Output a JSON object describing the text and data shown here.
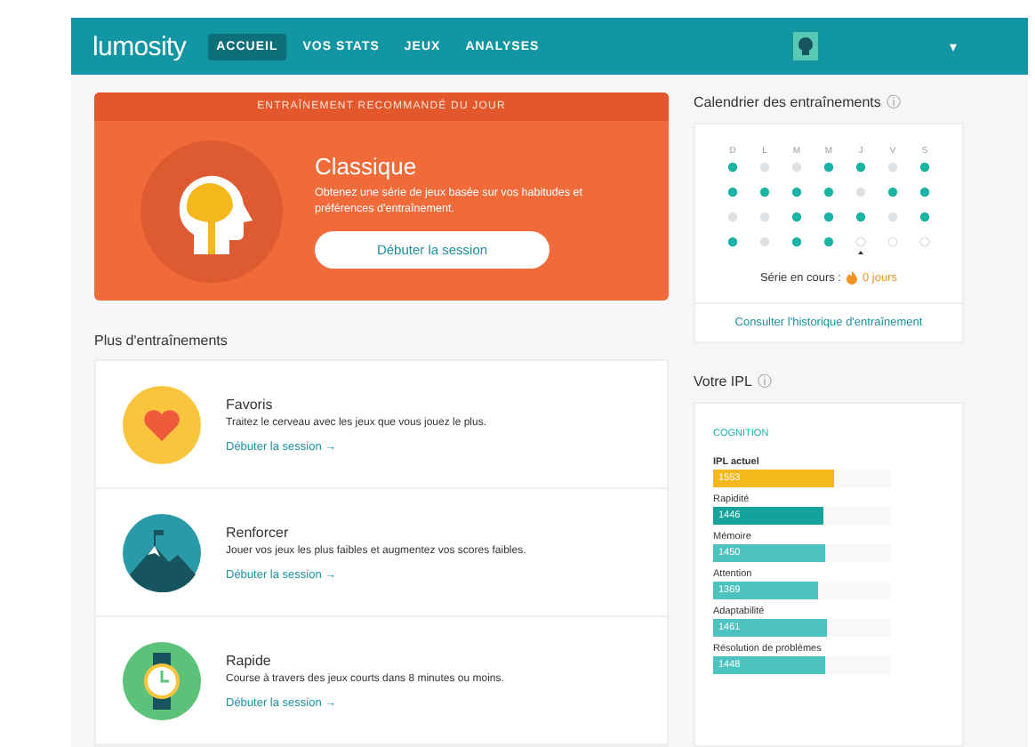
{
  "header": {
    "logo": "lumosity",
    "nav": [
      {
        "label": "ACCUEIL",
        "selected": true
      },
      {
        "label": "VOS STATS",
        "selected": false
      },
      {
        "label": "JEUX",
        "selected": false
      },
      {
        "label": "ANALYSES",
        "selected": false
      }
    ],
    "caret": "▾"
  },
  "recommended": {
    "banner": "ENTRAÎNEMENT RECOMMANDÉ DU JOUR",
    "title": "Classique",
    "description": "Obtenez une série de jeux basée sur vos habitudes et préférences d'entraînement.",
    "button": "Débuter la session"
  },
  "more": {
    "title": "Plus d'entraînements",
    "items": [
      {
        "kind": "heart",
        "title": "Favoris",
        "description": "Traitez le cerveau avec les jeux que vous jouez le plus.",
        "link": "Débuter la session →"
      },
      {
        "kind": "mountain",
        "title": "Renforcer",
        "description": "Jouer vos jeux les plus faibles et augmentez vos scores faibles.",
        "link": "Débuter la session →"
      },
      {
        "kind": "watch",
        "title": "Rapide",
        "description": "Course à travers des jeux courts dans 8 minutes ou moins.",
        "link": "Débuter la session →"
      }
    ]
  },
  "calendar": {
    "title": "Calendrier des entraînements",
    "info": "ⓘ",
    "days": [
      "D",
      "L",
      "M",
      "M",
      "J",
      "V",
      "S"
    ],
    "weeks": [
      [
        {
          "trained": true,
          "upcoming": false,
          "today": false
        },
        {
          "trained": false,
          "upcoming": false,
          "today": false
        },
        {
          "trained": false,
          "upcoming": false,
          "today": false
        },
        {
          "trained": true,
          "upcoming": false,
          "today": false
        },
        {
          "trained": true,
          "upcoming": false,
          "today": false
        },
        {
          "trained": false,
          "upcoming": false,
          "today": false
        },
        {
          "trained": true,
          "upcoming": false,
          "today": false
        }
      ],
      [
        {
          "trained": true,
          "upcoming": false,
          "today": false
        },
        {
          "trained": true,
          "upcoming": false,
          "today": false
        },
        {
          "trained": true,
          "upcoming": false,
          "today": false
        },
        {
          "trained": true,
          "upcoming": false,
          "today": false
        },
        {
          "trained": false,
          "upcoming": false,
          "today": false
        },
        {
          "trained": true,
          "upcoming": false,
          "today": false
        },
        {
          "trained": true,
          "upcoming": false,
          "today": false
        }
      ],
      [
        {
          "trained": false,
          "upcoming": false,
          "today": false
        },
        {
          "trained": false,
          "upcoming": false,
          "today": false
        },
        {
          "trained": true,
          "upcoming": false,
          "today": false
        },
        {
          "trained": true,
          "upcoming": false,
          "today": false
        },
        {
          "trained": true,
          "upcoming": false,
          "today": false
        },
        {
          "trained": false,
          "upcoming": false,
          "today": false
        },
        {
          "trained": true,
          "upcoming": false,
          "today": false
        }
      ],
      [
        {
          "trained": true,
          "upcoming": false,
          "today": false
        },
        {
          "trained": false,
          "upcoming": false,
          "today": false
        },
        {
          "trained": true,
          "upcoming": false,
          "today": false
        },
        {
          "trained": true,
          "upcoming": false,
          "today": false
        },
        {
          "trained": false,
          "upcoming": true,
          "today": true
        },
        {
          "trained": false,
          "upcoming": true,
          "today": false
        },
        {
          "trained": false,
          "upcoming": true,
          "today": false
        }
      ]
    ],
    "streak_label": "Série en cours :",
    "streak_value": "0 jours",
    "link": "Consulter l'historique d'entraînement"
  },
  "ipl": {
    "title": "Votre IPL",
    "info": "ⓘ",
    "section": "COGNITION",
    "bars": [
      {
        "label": "IPL actuel",
        "value": "1553",
        "level": 0.68,
        "color": "#f5b81c"
      },
      {
        "label": "Rapidité",
        "value": "1446",
        "level": 0.62,
        "color": "#13a39a"
      },
      {
        "label": "Mémoire",
        "value": "1450",
        "level": 0.63,
        "color": "#4cc3c0"
      },
      {
        "label": "Attention",
        "value": "1369",
        "level": 0.59,
        "color": "#4cc3c0"
      },
      {
        "label": "Adaptabilité",
        "value": "1461",
        "level": 0.64,
        "color": "#4cc3c0"
      },
      {
        "label": "Résolution de problèmes",
        "value": "1448",
        "level": 0.63,
        "color": "#4cc3c0"
      }
    ]
  }
}
